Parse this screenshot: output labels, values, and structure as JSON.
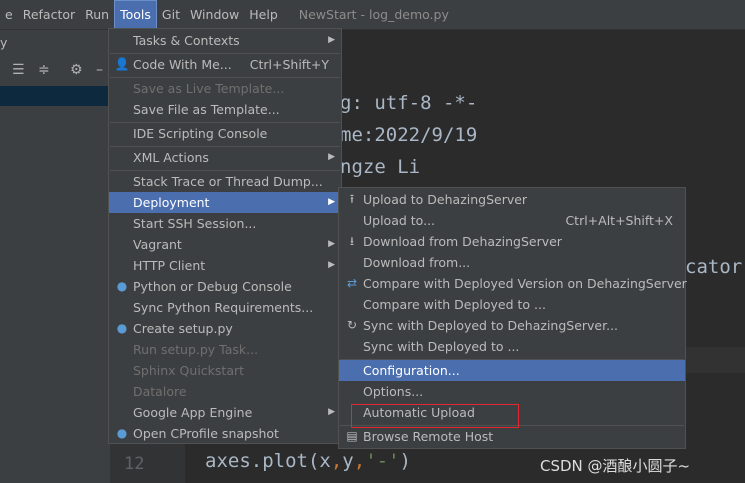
{
  "menubar": {
    "items": [
      "e",
      "Refactor",
      "Run",
      "Tools",
      "Git",
      "Window",
      "Help"
    ],
    "title": "NewStart - log_demo.py"
  },
  "subbar": {
    "text": "y"
  },
  "editor": {
    "lines": [
      "g: utf-8 -*-",
      "me:2022/9/19",
      "ngze Li",
      "cator"
    ],
    "gutter_line_number": "12",
    "code_line": {
      "a": "axes.plot(x",
      "c1": ",",
      "b": "y",
      "c2": ",",
      "s": "'-'",
      "close": ")"
    }
  },
  "tools_menu": {
    "items": [
      {
        "label": "Tasks & Contexts",
        "submenu": true
      },
      {
        "label": "Code With Me...",
        "shortcut": "Ctrl+Shift+Y",
        "icon": "user-icon"
      },
      {
        "label": "Save as Live Template...",
        "disabled": true
      },
      {
        "label": "Save File as Template..."
      },
      {
        "label": "IDE Scripting Console"
      },
      {
        "label": "XML Actions",
        "submenu": true
      },
      {
        "label": "Stack Trace or Thread Dump..."
      },
      {
        "label": "Deployment",
        "submenu": true,
        "highlighted": true
      },
      {
        "label": "Start SSH Session..."
      },
      {
        "label": "Vagrant",
        "submenu": true
      },
      {
        "label": "HTTP Client",
        "submenu": true
      },
      {
        "label": "Python or Debug Console",
        "icon": "python-icon"
      },
      {
        "label": "Sync Python Requirements..."
      },
      {
        "label": "Create setup.py",
        "icon": "python-icon"
      },
      {
        "label": "Run setup.py Task...",
        "disabled": true
      },
      {
        "label": "Sphinx Quickstart",
        "disabled": true
      },
      {
        "label": "Datalore",
        "disabled": true
      },
      {
        "label": "Google App Engine",
        "submenu": true
      },
      {
        "label": "Open CProfile snapshot",
        "icon": "python-icon"
      }
    ]
  },
  "deployment_menu": {
    "items": [
      {
        "label": "Upload to DehazingServer",
        "icon": "upload-icon"
      },
      {
        "label": "Upload to...",
        "shortcut": "Ctrl+Alt+Shift+X"
      },
      {
        "label": "Download from DehazingServer",
        "icon": "download-icon"
      },
      {
        "label": "Download from..."
      },
      {
        "label": "Compare with Deployed Version on DehazingServer",
        "icon": "compare-icon"
      },
      {
        "label": "Compare with Deployed to ..."
      },
      {
        "label": "Sync with Deployed to DehazingServer...",
        "icon": "sync-icon"
      },
      {
        "label": "Sync with Deployed to ..."
      },
      {
        "label": "Configuration...",
        "highlighted": true
      },
      {
        "label": "Options..."
      },
      {
        "label": "Automatic Upload"
      },
      {
        "label": "Browse Remote Host",
        "icon": "server-icon"
      }
    ]
  },
  "watermark": "CSDN @酒酿小圆子~",
  "colors": {
    "highlight": "#4b6eaf",
    "annotation_box": "#e0282e"
  }
}
